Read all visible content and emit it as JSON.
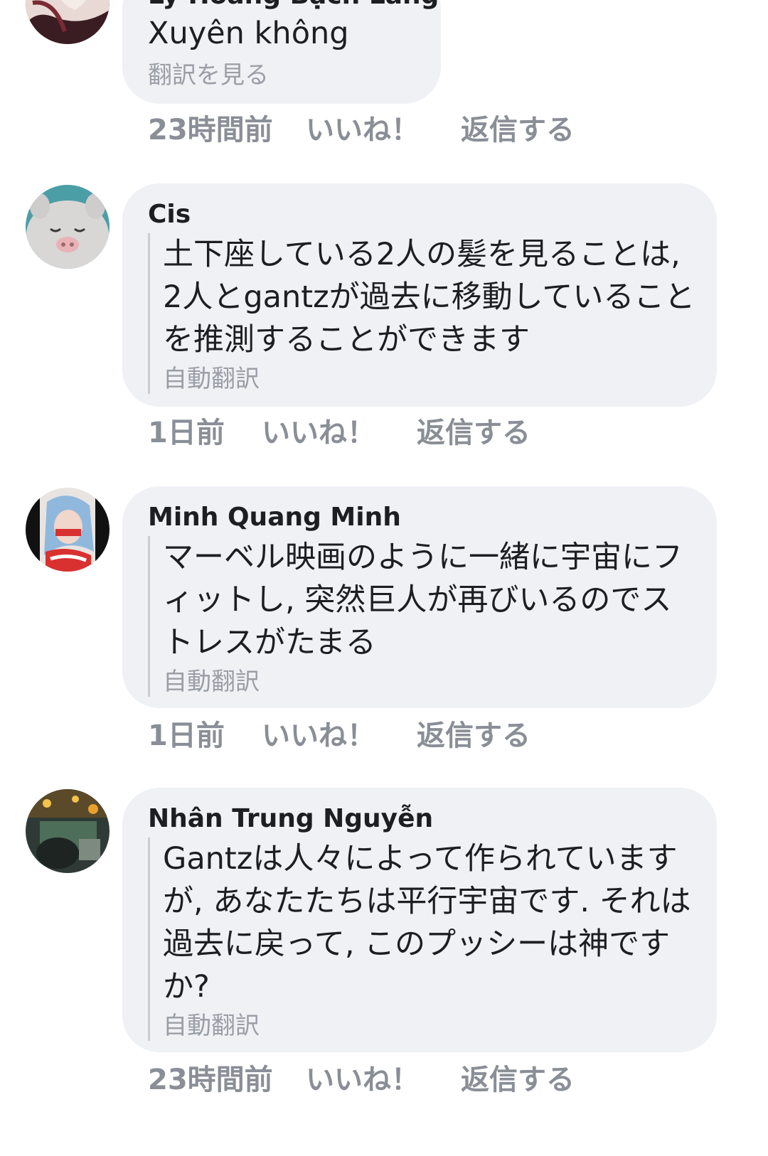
{
  "comments": [
    {
      "author": "Ly Hoàng Bạch Lang",
      "text": "Xuyên không",
      "translate_label": "翻訳を見る",
      "time": "23時間前",
      "like": "いいね！",
      "reply": "返信する"
    },
    {
      "author": "Cis",
      "text": "土下座している2人の髪を見ることは, 2人とgantzが過去に移動していることを推測することができます",
      "translate_label": "自動翻訳",
      "time": "1日前",
      "like": "いいね！",
      "reply": "返信する"
    },
    {
      "author": "Minh Quang Minh",
      "text": "マーベル映画のように一緒に宇宙にフィットし, 突然巨人が再びいるのでストレスがたまる",
      "translate_label": "自動翻訳",
      "time": "1日前",
      "like": "いいね！",
      "reply": "返信する"
    },
    {
      "author": "Nhân Trung Nguyễn",
      "text": "Gantzは人々によって作られていますが, あなたたちは平行宇宙です. それは過去に戻って, このプッシーは神ですか?",
      "translate_label": "自動翻訳",
      "time": "23時間前",
      "like": "いいね！",
      "reply": "返信する"
    }
  ]
}
